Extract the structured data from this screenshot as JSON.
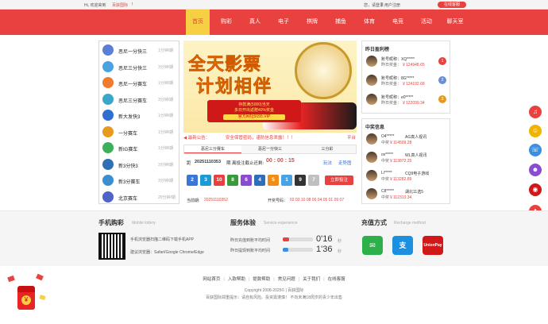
{
  "topbar": {
    "greeting": "Hi, 欢迎来到",
    "brand": "百获国际",
    "sep": "!",
    "login": "您，请登录",
    "sep2": "|",
    "register": "用户注册",
    "online_service": "在线客服"
  },
  "nav": {
    "items": [
      "首页",
      "购彩",
      "真人",
      "电子",
      "棋牌",
      "捕鱼",
      "体育",
      "电竞",
      "活动",
      "聊天室"
    ],
    "active": 0
  },
  "lotteries": [
    {
      "name": "恶尼一分快三",
      "time": "1分钟/期",
      "color": "#5b7fd6"
    },
    {
      "name": "恶尼三分快三",
      "time": "3分钟/期",
      "color": "#4aa3e0"
    },
    {
      "name": "恶尼一分赛车",
      "time": "1分钟/期",
      "color": "#f27a2e"
    },
    {
      "name": "恶尼三分赛车",
      "time": "3分钟/期",
      "color": "#3aa6c9"
    },
    {
      "name": "新大发快3",
      "time": "1分钟/期",
      "color": "#2e6fd0"
    },
    {
      "name": "一分赛车",
      "time": "1分钟/期",
      "color": "#e89a1e"
    },
    {
      "name": "新IG赛车",
      "time": "1分钟/期",
      "color": "#3cb05a"
    },
    {
      "name": "新3分快3",
      "time": "3分钟/期",
      "color": "#2f6fb8"
    },
    {
      "name": "新3分赛车",
      "time": "3分钟/期",
      "color": "#3a8fcf"
    },
    {
      "name": "北京赛车",
      "time": "20分钟/期",
      "color": "#4e64c7"
    }
  ],
  "banner": {
    "line1": "全天影票",
    "line2": "计划相伴",
    "sub1": "存款满(5000)当天",
    "sub2": "多日开出返赠40%奖金",
    "sub3": "官方网址9155.VIP"
  },
  "notice": {
    "label": "最新公告：",
    "text": "安全保管密码，谨防信息泄露！！！",
    "tail": "平台"
  },
  "tabs": [
    "恶尼三分赛车",
    "恶尼一分快三",
    "三分彩"
  ],
  "draw": {
    "label1": "距",
    "issue": "20251110353",
    "label2": "期 离投注截止还剩:",
    "countdown": "00 : 00 : 15",
    "rule": "玩法",
    "trend": "走势图"
  },
  "balls": [
    {
      "v": "2",
      "c": "#3a76d8"
    },
    {
      "v": "3",
      "c": "#1c9ad6"
    },
    {
      "v": "10",
      "c": "#e8413f"
    },
    {
      "v": "8",
      "c": "#3a9a3a"
    },
    {
      "v": "6",
      "c": "#8a4dcf"
    },
    {
      "v": "4",
      "c": "#2e6fb8"
    },
    {
      "v": "5",
      "c": "#f08c1a"
    },
    {
      "v": "1",
      "c": "#4aa3e0"
    },
    {
      "v": "9",
      "c": "#333"
    },
    {
      "v": "7",
      "c": "#c0c0c0"
    }
  ],
  "bet_button": "立即投注",
  "period": {
    "label1": "当前期:",
    "issue": "20251110352",
    "label2": "开奖号码：",
    "numbers": "02 03 10 08 06 04 05 01 09 07"
  },
  "rank": {
    "title": "昨日盈利榜",
    "rows": [
      {
        "name": "账号昵称：XQ*****",
        "amt_label": "昨日奖金：",
        "amt": "￥124948.65",
        "n": "1",
        "mc": "#e8413f"
      },
      {
        "name": "账号昵称：8G*****",
        "amt_label": "昨日奖金：",
        "amt": "￥124192.68",
        "n": "2",
        "mc": "#6b8fd6"
      },
      {
        "name": "账号昵称：e0*****",
        "amt_label": "昨日奖金：",
        "amt": "￥122099.34",
        "n": "3",
        "mc": "#e89a1e"
      }
    ]
  },
  "winners": {
    "title": "中奖信息",
    "rows": [
      {
        "name": "O4*****",
        "game": "AG真人视讯",
        "label": "中奖",
        "amt": "￥114509.28"
      },
      {
        "name": "ov*****",
        "game": "WL真人视讯",
        "label": "中奖",
        "amt": "￥113872.25"
      },
      {
        "name": "Li*****",
        "game": "CQ9电子游戏",
        "label": "中奖",
        "amt": "￥113282.89"
      },
      {
        "name": "C8*****",
        "game": "湖北11选5",
        "label": "中奖",
        "amt": "￥112313.34"
      }
    ]
  },
  "side_icons": [
    {
      "name": "bell",
      "c": "#e8413f",
      "g": "♫"
    },
    {
      "name": "chat",
      "c": "#f0b400",
      "g": "☺"
    },
    {
      "name": "service",
      "c": "#3a8fe0",
      "g": "☏"
    },
    {
      "name": "user",
      "c": "#8a4dcf",
      "g": "☻"
    },
    {
      "name": "wheel",
      "c": "#d01818",
      "g": "◉"
    },
    {
      "name": "gift",
      "c": "#e8413f",
      "g": "♣"
    },
    {
      "name": "qr",
      "c": "#555",
      "g": "▦"
    }
  ],
  "mobile": {
    "title": "手机购彩",
    "sub": "Mobile lottery",
    "line1": "手机浏览器扫描二维码下载手机APP",
    "line2": "建议浏览器：Safari/Google Chrome/Edge"
  },
  "service": {
    "title": "服务体验",
    "sub": "Service experience",
    "row1": "昨日充值到账平均时间",
    "row2": "昨日提现到账平均时间",
    "t1": "0'16",
    "t2": "1'36",
    "unit": "秒",
    "fill1": 0.22,
    "fill2": 0.18
  },
  "payment": {
    "title": "充值方式",
    "sub": "Recharge method",
    "icons": [
      {
        "g": "✉",
        "c": "#2cb14a"
      },
      {
        "g": "支",
        "c": "#1b8fe0"
      },
      {
        "g": "UnionPay",
        "c": "#d01818"
      }
    ]
  },
  "footer": {
    "links": [
      "网站首页",
      "入款帮助",
      "提款帮助",
      "常见问题",
      "关于我们",
      "在线客服"
    ],
    "copyright": "Copyright 2008-2025© | 百获国际",
    "warning": "百获国际郑重提示：请自有风险。投资需谨慎！  不向未满18周岁的青少年出售"
  }
}
